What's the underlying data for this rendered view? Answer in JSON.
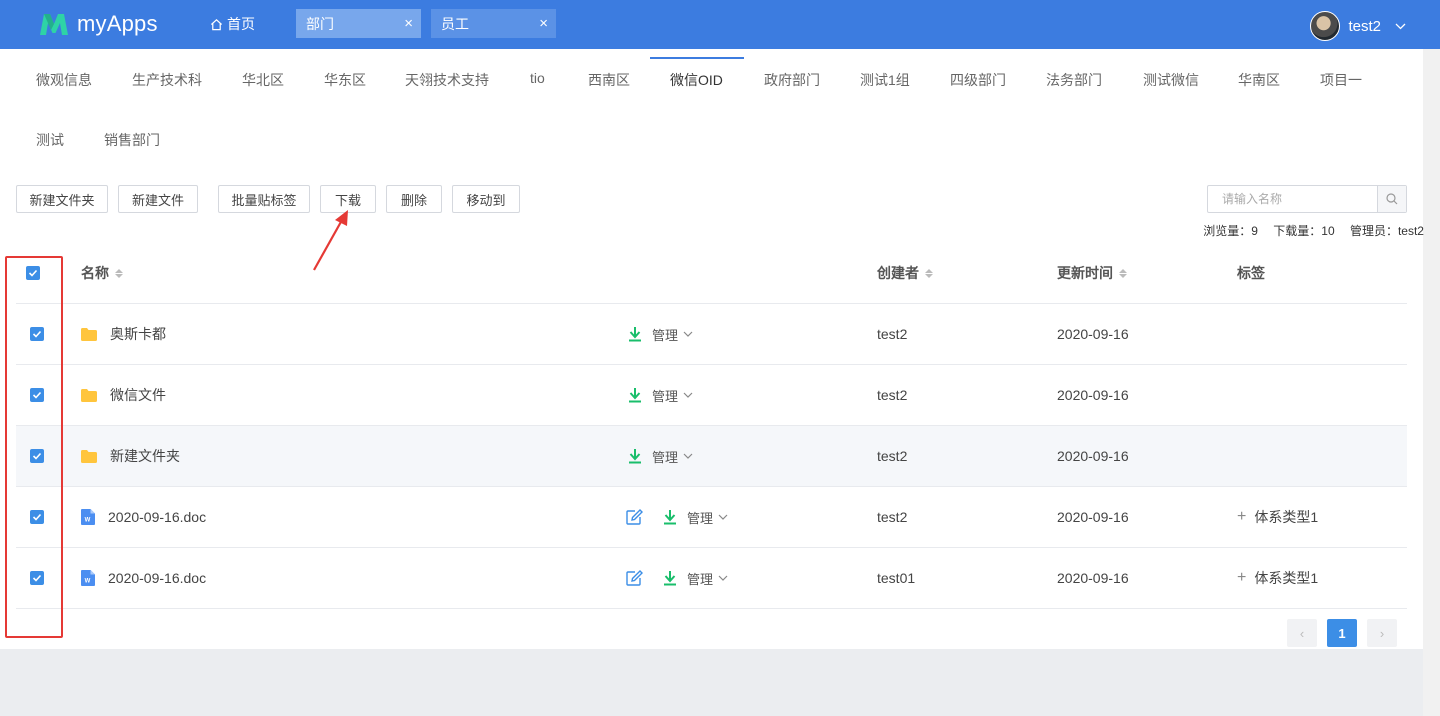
{
  "app": {
    "name": "myApps"
  },
  "header": {
    "home_label": "首页",
    "tabs": [
      {
        "label": "部门",
        "close": "×"
      },
      {
        "label": "员工",
        "close": "×"
      }
    ],
    "user": "test2"
  },
  "departments": {
    "row1": [
      "微观信息",
      "生产技术科",
      "华北区",
      "华东区",
      "天翎技术支持",
      "tio",
      "西南区",
      "微信OID",
      "政府部门",
      "测试1组",
      "四级部门",
      "法务部门",
      "测试微信",
      "华南区",
      "项目一"
    ],
    "row2": [
      "测试",
      "销售部门"
    ],
    "active": "微信OID"
  },
  "toolbar": {
    "new_folder": "新建文件夹",
    "new_file": "新建文件",
    "batch_tag": "批量贴标签",
    "download": "下载",
    "delete": "删除",
    "move_to": "移动到",
    "search_placeholder": "请输入名称"
  },
  "stats": {
    "views": "浏览量：9",
    "downloads": "下载量：10",
    "admin": "管理员：test2"
  },
  "table": {
    "columns": {
      "name": "名称",
      "creator": "创建者",
      "updated": "更新时间",
      "tags": "标签"
    },
    "manage_label": "管理",
    "rows": [
      {
        "type": "folder",
        "name": "奥斯卡都",
        "creator": "test2",
        "updated": "2020-09-16",
        "tag": "",
        "checked": true
      },
      {
        "type": "folder",
        "name": "微信文件",
        "creator": "test2",
        "updated": "2020-09-16",
        "tag": "",
        "checked": true
      },
      {
        "type": "folder",
        "name": "新建文件夹",
        "creator": "test2",
        "updated": "2020-09-16",
        "tag": "",
        "checked": true
      },
      {
        "type": "doc",
        "name": "2020-09-16.doc",
        "creator": "test2",
        "updated": "2020-09-16",
        "tag": "体系类型1",
        "checked": true
      },
      {
        "type": "doc",
        "name": "2020-09-16.doc",
        "creator": "test01",
        "updated": "2020-09-16",
        "tag": "体系类型1",
        "checked": true
      }
    ]
  },
  "pagination": {
    "prev": "‹",
    "current": "1",
    "next": "›"
  },
  "colors": {
    "primary": "#3c7ce0",
    "checkbox": "#3c8ee6",
    "download_green": "#19be6b",
    "folder": "#ffc53d",
    "highlight_red": "#e53935"
  }
}
